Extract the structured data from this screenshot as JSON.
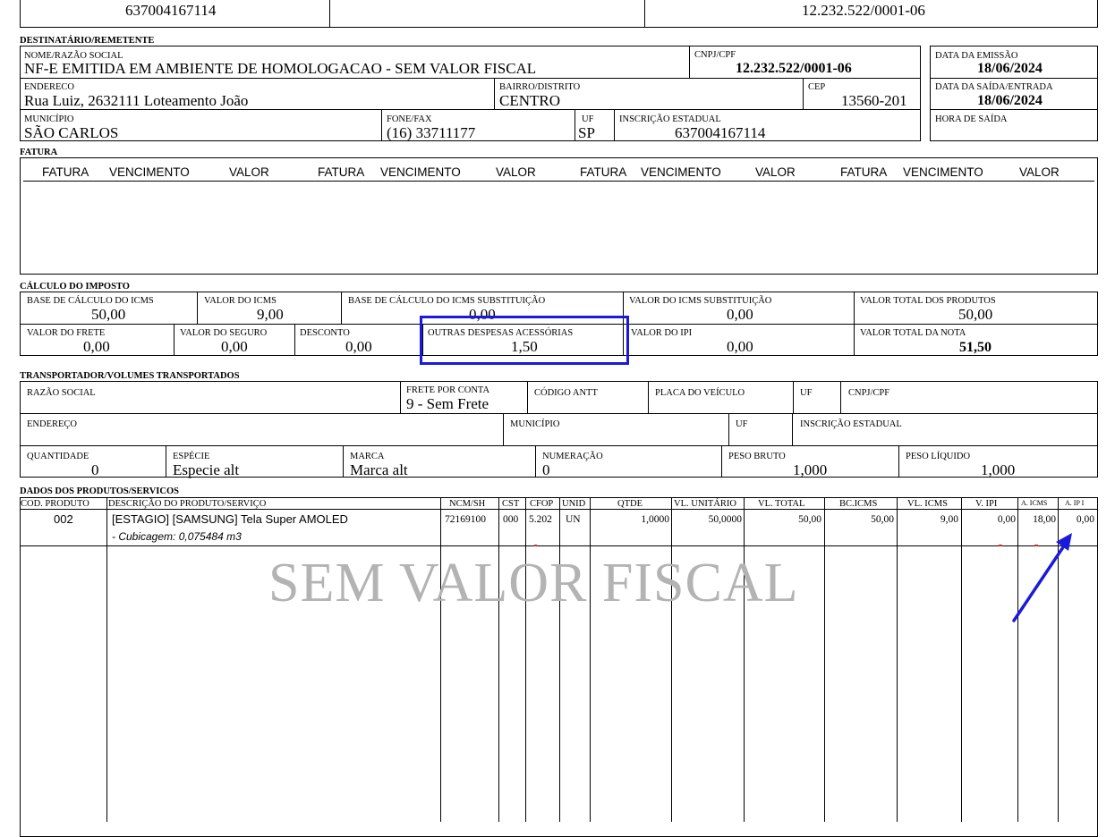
{
  "top": {
    "ie": "637004167114",
    "cnpj": "12.232.522/0001-06"
  },
  "dest": {
    "section": "DESTINATÁRIO/REMETENTE",
    "nome_lbl": "NOME/RAZÃO SOCIAL",
    "nome": "NF-E EMITIDA EM AMBIENTE DE HOMOLOGACAO - SEM VALOR FISCAL",
    "cnpj_lbl": "CNPJ/CPF",
    "cnpj": "12.232.522/0001-06",
    "emissao_lbl": "DATA DA EMISSÃO",
    "emissao": "18/06/2024",
    "end_lbl": "ENDERECO",
    "end": "Rua Luiz, 2632111  Loteamento João",
    "bairro_lbl": "BAIRRO/DISTRITO",
    "bairro": "CENTRO",
    "cep_lbl": "CEP",
    "cep": "13560-201",
    "saida_lbl": "DATA DA SAÍDA/ENTRADA",
    "saida": "18/06/2024",
    "mun_lbl": "MUNICÍPIO",
    "mun": "SÃO CARLOS",
    "fone_lbl": "FONE/FAX",
    "fone": "(16) 33711177",
    "uf_lbl": "UF",
    "uf": "SP",
    "ie_lbl": "INSCRIÇÃO ESTADUAL",
    "ie": "637004167114",
    "hora_lbl": "HORA DE SAÍDA"
  },
  "fatura": {
    "section": "FATURA",
    "headers": [
      "FATURA",
      "VENCIMENTO",
      "VALOR",
      "FATURA",
      "VENCIMENTO",
      "VALOR",
      "FATURA",
      "VENCIMENTO",
      "VALOR",
      "FATURA",
      "VENCIMENTO",
      "VALOR"
    ]
  },
  "imposto": {
    "section": "CÁLCULO DO IMPOSTO",
    "bc_icms_lbl": "BASE DE CÁLCULO DO ICMS",
    "bc_icms": "50,00",
    "v_icms_lbl": "VALOR DO ICMS",
    "v_icms": "9,00",
    "bc_st_lbl": "BASE DE CÁLCULO DO ICMS SUBSTITUIÇÃO",
    "bc_st": "0,00",
    "v_st_lbl": "VALOR DO ICMS SUBSTITUIÇÃO",
    "v_st": "0,00",
    "v_prod_lbl": "VALOR TOTAL DOS PRODUTOS",
    "v_prod": "50,00",
    "frete_lbl": "VALOR DO FRETE",
    "frete": "0,00",
    "seguro_lbl": "VALOR DO SEGURO",
    "seguro": "0,00",
    "desc_lbl": "DESCONTO",
    "desc": "0,00",
    "outras_lbl": "OUTRAS DESPESAS ACESSÓRIAS",
    "outras": "1,50",
    "ipi_lbl": "VALOR DO IPI",
    "ipi": "0,00",
    "v_nota_lbl": "VALOR TOTAL DA NOTA",
    "v_nota": "51,50"
  },
  "transp": {
    "section": "TRANSPORTADOR/VOLUMES TRANSPORTADOS",
    "razao_lbl": "RAZÃO SOCIAL",
    "frete_lbl": "FRETE POR CONTA",
    "frete": "9 - Sem Frete",
    "antt_lbl": "CÓDIGO ANTT",
    "placa_lbl": "PLACA DO VEÍCULO",
    "uf_lbl": "UF",
    "cnpj_lbl": "CNPJ/CPF",
    "end_lbl": "ENDEREÇO",
    "mun_lbl": "MUNICÍPIO",
    "uf2_lbl": "UF",
    "ie_lbl": "INSCRIÇÃO ESTADUAL",
    "qtd_lbl": "QUANTIDADE",
    "qtd": "0",
    "esp_lbl": "ESPÉCIE",
    "esp": "Especie alt",
    "marca_lbl": "MARCA",
    "marca": "Marca alt",
    "num_lbl": "NUMERAÇÃO",
    "num": "0",
    "bruto_lbl": "PESO BRUTO",
    "bruto": "1,000",
    "liq_lbl": "PESO LÍQUIDO",
    "liq": "1,000"
  },
  "produtos": {
    "section": "DADOS DOS PRODUTOS/SERVICOS",
    "headers": [
      "COD. PRODUTO",
      "DESCRIÇÃO DO PRODUTO/SERVIÇO",
      "NCM/SH",
      "CST",
      "CFOP",
      "UNID",
      "QTDE",
      "VL. UNITÁRIO",
      "VL. TOTAL",
      "BC.ICMS",
      "VL. ICMS",
      "V. IPI",
      "A. ICMS",
      "A. IP I"
    ],
    "row": {
      "cod": "002",
      "desc": "[ESTAGIO] [SAMSUNG] Tela Super AMOLED",
      "desc2": "- Cubicagem: 0,075484 m3",
      "ncm": "72169100",
      "cst": "000",
      "cfop": "5.202",
      "unid": "UN",
      "qtde": "1,0000",
      "vunit": "50,0000",
      "vtotal": "50,00",
      "bcicms": "50,00",
      "vicms": "9,00",
      "vipi": "0,00",
      "aicms": "18,00",
      "aipi": "0,00"
    }
  },
  "watermark": "SEM VALOR FISCAL",
  "colors": {
    "annotation": "#1a1adb",
    "mark": "#e02020"
  }
}
